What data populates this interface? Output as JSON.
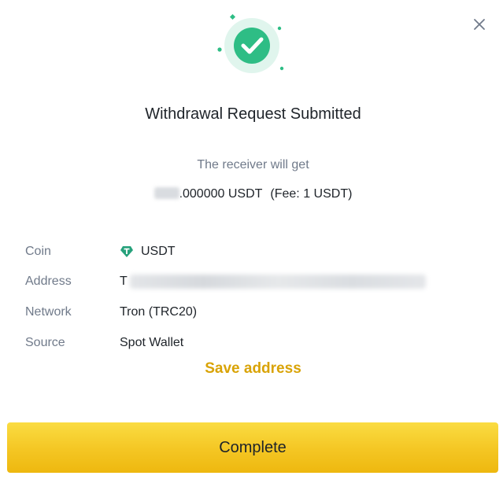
{
  "dialog": {
    "title": "Withdrawal Request Submitted",
    "receiver_text": "The receiver will get",
    "amount_visible": ".000000 USDT",
    "fee_text": "(Fee: 1 USDT)"
  },
  "details": {
    "coin": {
      "label": "Coin",
      "value": "USDT",
      "icon": "tether-diamond-icon"
    },
    "address": {
      "label": "Address",
      "value_prefix": "T"
    },
    "network": {
      "label": "Network",
      "value": "Tron (TRC20)"
    },
    "source": {
      "label": "Source",
      "value": "Spot Wallet"
    }
  },
  "actions": {
    "save_address": "Save address",
    "complete": "Complete"
  },
  "colors": {
    "success_green": "#2ebd85",
    "accent_gold": "#d9a306",
    "button_yellow": "#f4c623",
    "muted_text": "#707a8a",
    "primary_text": "#1e2329"
  }
}
